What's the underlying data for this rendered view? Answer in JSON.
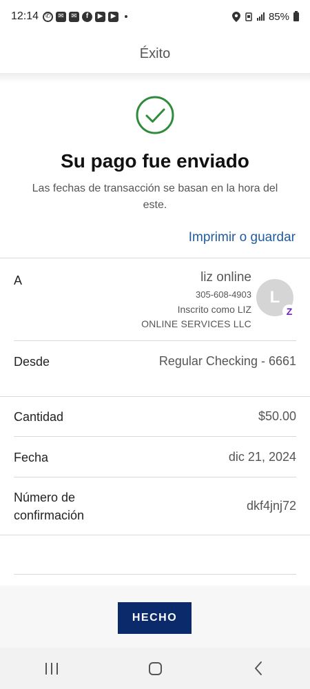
{
  "status_bar": {
    "time": "12:14",
    "apps": [
      "whatsapp-icon",
      "messages-icon",
      "messages-icon",
      "facebook-icon",
      "youtube-icon",
      "youtube-icon"
    ],
    "battery": "85%"
  },
  "header": {
    "title": "Éxito"
  },
  "success": {
    "icon": "check-circle-icon",
    "accent_color": "#2e8b3a",
    "title": "Su pago fue enviado",
    "subtitle": "Las fechas de transacción se basan en la hora del este.",
    "print_link": "Imprimir o guardar"
  },
  "details": {
    "to": {
      "label": "A",
      "name": "liz online",
      "phone": "305-608-4903",
      "registered_line1": "Inscrito como LIZ",
      "registered_line2": "ONLINE SERVICES LLC",
      "avatar_letter": "L",
      "badge": "Z"
    },
    "from": {
      "label": "Desde",
      "value": "Regular Checking - 6661"
    },
    "amount": {
      "label": "Cantidad",
      "value": "$50.00"
    },
    "date": {
      "label": "Fecha",
      "value": "dic 21, 2024"
    },
    "confirmation": {
      "label_line1": "Número de",
      "label_line2": "confirmación",
      "value": "dkf4jnj72"
    }
  },
  "footer": {
    "done_label": "HECHO",
    "button_color": "#0b2a6b"
  },
  "navbar": {
    "items": [
      "recent-apps-icon",
      "home-icon",
      "back-icon"
    ]
  }
}
